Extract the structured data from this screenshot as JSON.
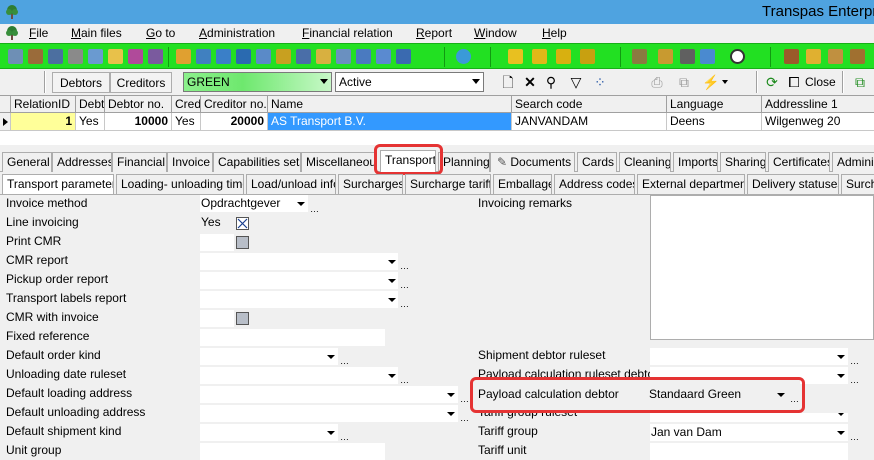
{
  "window": {
    "title": "Transpas Enterpr"
  },
  "menu": [
    {
      "label": "File",
      "u": "F"
    },
    {
      "label": "Main files",
      "u": "M"
    },
    {
      "label": "Go to",
      "u": "G"
    },
    {
      "label": "Administration",
      "u": "A"
    },
    {
      "label": "Financial relation",
      "u": "F"
    },
    {
      "label": "Report",
      "u": "R"
    },
    {
      "label": "Window",
      "u": "W"
    },
    {
      "label": "Help",
      "u": "H"
    }
  ],
  "filterbar": {
    "debtors_label": "Debtors",
    "creditors_label": "Creditors",
    "filter_value": "GREEN",
    "status_value": "Active",
    "close_label": "Close"
  },
  "grid": {
    "columns": [
      "RelationID",
      "Debtor",
      "Debtor no.",
      "Creditor",
      "Creditor no.",
      "Name",
      "Search code",
      "Language",
      "Addressline 1"
    ],
    "row": [
      "1",
      "Yes",
      "10000",
      "Yes",
      "20000",
      "AS Transport B.V.",
      "JANVANDAM",
      "Deens",
      "Wilgenweg 20"
    ]
  },
  "tabs_main": [
    "General",
    "Addresses",
    "Financial",
    "Invoice",
    "Capabilities sets",
    "Miscellaneous",
    "Transport",
    "Planning",
    "Documents",
    "Cards",
    "Cleaning",
    "Imports",
    "Sharing",
    "Certificates",
    "Administ"
  ],
  "tabs_sub": [
    "Transport parameters",
    "Loading- unloading times",
    "Load/unload info",
    "Surcharges",
    "Surcharge tariffs",
    "Emballage",
    "Address codes",
    "External departments",
    "Delivery statuses",
    "Surcha"
  ],
  "form_left": {
    "invoice_method": {
      "label": "Invoice method",
      "value": "Opdrachtgever"
    },
    "line_invoicing": {
      "label": "Line invoicing",
      "value": "Yes"
    },
    "print_cmr": {
      "label": "Print CMR"
    },
    "cmr_report": {
      "label": "CMR report"
    },
    "pickup_order_report": {
      "label": "Pickup order report"
    },
    "transport_labels_report": {
      "label": "Transport labels report"
    },
    "cmr_with_invoice": {
      "label": "CMR with invoice"
    },
    "fixed_reference": {
      "label": "Fixed reference"
    },
    "default_order_kind": {
      "label": "Default order kind"
    },
    "unloading_date_ruleset": {
      "label": "Unloading date ruleset"
    },
    "default_loading_address": {
      "label": "Default loading address"
    },
    "default_unloading_address": {
      "label": "Default unloading address"
    },
    "default_shipment_kind": {
      "label": "Default shipment kind"
    },
    "unit_group": {
      "label": "Unit group"
    }
  },
  "form_right": {
    "invoicing_remarks": {
      "label": "Invoicing remarks"
    },
    "shipment_debtor_ruleset": {
      "label": "Shipment debtor ruleset"
    },
    "payload_calc_ruleset_debtor": {
      "label": "Payload calculation ruleset debtor"
    },
    "payload_calc_debtor": {
      "label": "Payload calculation debtor",
      "value": "Standaard Green"
    },
    "tariff_group_ruleset": {
      "label": "Tariff group ruleset"
    },
    "tariff_group": {
      "label": "Tariff group",
      "value": "Jan van Dam"
    },
    "tariff_unit": {
      "label": "Tariff unit"
    }
  },
  "colors": {
    "titlebar": "#4fa3e0",
    "toolbar_green": "#22e022",
    "highlight": "#e53333",
    "selection": "#3399ff",
    "current_cell": "#ffff99"
  }
}
